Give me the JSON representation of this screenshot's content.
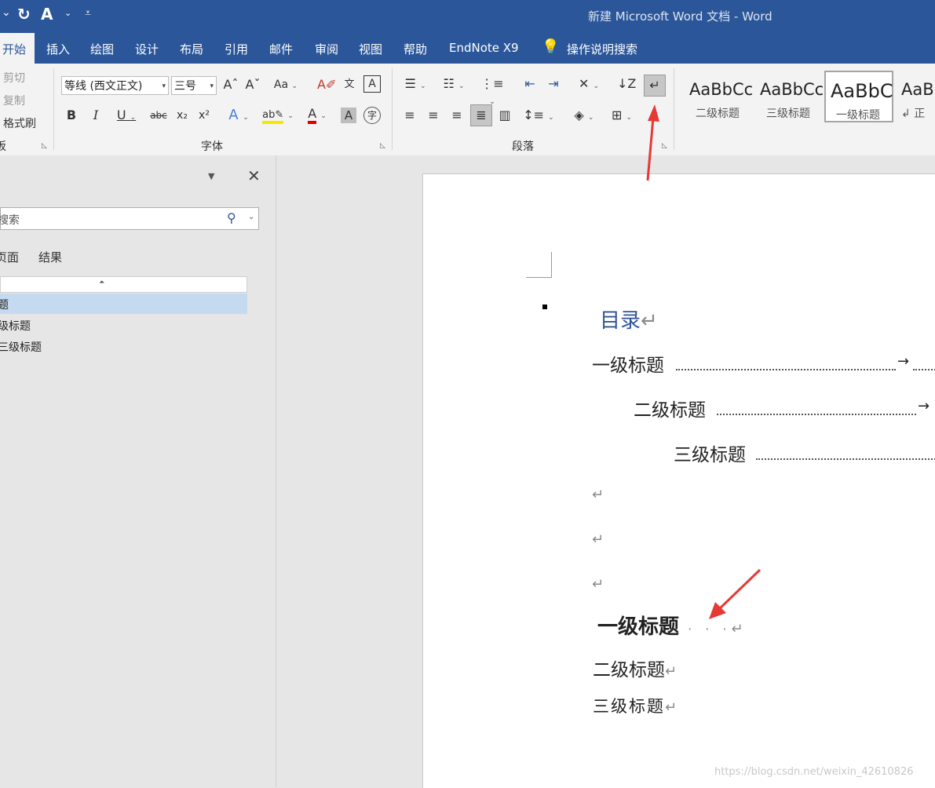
{
  "window": {
    "title": "新建 Microsoft Word 文档  -  Word"
  },
  "tabs": [
    "开始",
    "插入",
    "绘图",
    "设计",
    "布局",
    "引用",
    "邮件",
    "审阅",
    "视图",
    "帮助",
    "EndNote X9",
    "操作说明搜索"
  ],
  "ribbon": {
    "clipboard": {
      "cut": "剪切",
      "copy": "复制",
      "format_painter": "格式刷",
      "label": "板"
    },
    "font": {
      "name": "等线 (西文正文)",
      "size": "三号",
      "label": "字体"
    },
    "paragraph": {
      "label": "段落"
    },
    "styles": [
      {
        "sample": "AaBbCc",
        "name": "二级标题"
      },
      {
        "sample": "AaBbCc",
        "name": "三级标题"
      },
      {
        "sample": "AaBbC",
        "name": "一级标题"
      },
      {
        "sample": "AaBb",
        "name": "正"
      }
    ]
  },
  "nav_pane": {
    "search_placeholder": "搜索",
    "tabs": [
      "页面",
      "结果"
    ],
    "headings": [
      "题",
      "级标题",
      "三级标题"
    ]
  },
  "document": {
    "toc_title": "目录",
    "toc_entries": [
      {
        "text": "一级标题"
      },
      {
        "text": "二级标题"
      },
      {
        "text": "三级标题"
      }
    ],
    "headings": [
      "一级标题",
      "二级标题",
      "三级标题"
    ]
  },
  "watermark": "https://blog.csdn.net/weixin_42610826",
  "colors": {
    "accent": "#2b579a",
    "arrow": "#e53935"
  }
}
